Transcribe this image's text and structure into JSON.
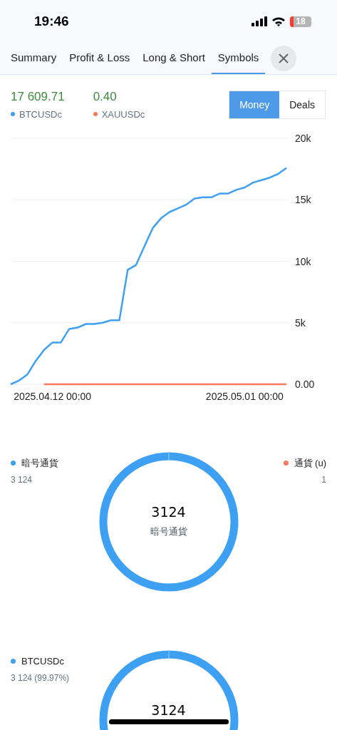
{
  "status_bar": {
    "time": "19:46",
    "battery": "18"
  },
  "tabs": [
    {
      "label": "Summary",
      "selected": false
    },
    {
      "label": "Profit & Loss",
      "selected": false
    },
    {
      "label": "Long & Short",
      "selected": false
    },
    {
      "label": "Symbols",
      "selected": true
    }
  ],
  "summary": [
    {
      "value": "17 609.71"
    },
    {
      "value": "0.40"
    }
  ],
  "toggle": [
    {
      "label": "Money",
      "selected": true
    },
    {
      "label": "Deals",
      "selected": false
    }
  ],
  "chart_data": {
    "type": "line",
    "categories": [
      null,
      null,
      null,
      null,
      null,
      "2025.04.12 00:00",
      null,
      null,
      null,
      null,
      null,
      null,
      null,
      null,
      null,
      null,
      null,
      null,
      null,
      null,
      null,
      null,
      null,
      null,
      null,
      null,
      null,
      null,
      "2025.05.01 00:00",
      null,
      null,
      null,
      null,
      null
    ],
    "ylim": [
      0,
      20000
    ],
    "grid": true,
    "yticks": [
      {
        "value": 0,
        "label": "0.00"
      },
      {
        "value": 5000,
        "label": "5k"
      },
      {
        "value": 10000,
        "label": "10k"
      },
      {
        "value": 15000,
        "label": "15k"
      },
      {
        "value": 20000,
        "label": "20k"
      }
    ],
    "series": [
      {
        "name": "BTCUSDc",
        "color": "#3ea0f2",
        "values": [
          0,
          300,
          800,
          1900,
          2800,
          3400,
          3400,
          4500,
          4600,
          4900,
          4900,
          5000,
          5200,
          5200,
          9300,
          9700,
          11200,
          12700,
          13500,
          14000,
          14300,
          14600,
          15100,
          15200,
          15200,
          15500,
          15500,
          15800,
          16000,
          16400,
          16600,
          16800,
          17100,
          17600
        ]
      },
      {
        "name": "XAUUSDc",
        "color": "#fa7a5f",
        "values": [
          null,
          null,
          null,
          null,
          0,
          0,
          0,
          0,
          0,
          0,
          0,
          0,
          0,
          0,
          0,
          0,
          0,
          0,
          0,
          0,
          0,
          0,
          0,
          0,
          0,
          0,
          0,
          0,
          0,
          0,
          0,
          0,
          0,
          0
        ]
      }
    ]
  },
  "donuts": [
    {
      "legend": [
        {
          "name": "暗号通貨",
          "value": "3 124",
          "color": "#3ea0f2"
        },
        {
          "name": "通貨 (u)",
          "value": "1",
          "color": "#fa7a5f"
        }
      ],
      "center_value": "3124",
      "center_label": "暗号通貨"
    },
    {
      "legend": [
        {
          "name": "BTCUSDc",
          "value": "3 124 (99.97%)",
          "color": "#3ea0f2"
        }
      ],
      "center_value": "3124"
    }
  ]
}
